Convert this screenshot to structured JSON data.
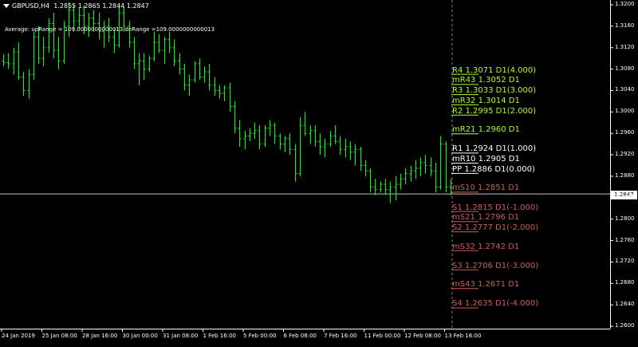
{
  "header": {
    "symbol_timeframe": "GBPUSD,H4",
    "ohlc": "1.2855 1.2865 1.2844 1.2847"
  },
  "indicator_text": "Average: upRange = 109.0000000000013 dnRange =109.0000000000013",
  "current_price_label": "1.2847",
  "colors": {
    "background": "#000000",
    "candle": "#00ff00",
    "axis": "#ffffff",
    "resistance": "#adff2f",
    "pivot": "#ffffff",
    "support": "#cd5c5c",
    "current_line": "#c0c0c0"
  },
  "levels": [
    {
      "label": "R4 1.3071 D1(4.000)",
      "price": 1.3071,
      "kind": "resistance"
    },
    {
      "label": "mR43 1.3052 D1",
      "price": 1.3052,
      "kind": "resistance"
    },
    {
      "label": "R3 1.3033 D1(3.000)",
      "price": 1.3033,
      "kind": "resistance"
    },
    {
      "label": "mR32 1.3014 D1",
      "price": 1.3014,
      "kind": "resistance"
    },
    {
      "label": "R2 1.2995 D1(2.000)",
      "price": 1.2995,
      "kind": "resistance"
    },
    {
      "label": "mR21 1.2960 D1",
      "price": 1.296,
      "kind": "resistance"
    },
    {
      "label": "R1 1.2924 D1(1.000)",
      "price": 1.2924,
      "kind": "pivot"
    },
    {
      "label": "mR10 1.2905 D1",
      "price": 1.2905,
      "kind": "pivot"
    },
    {
      "label": "PP 1.2886 D1(0.000)",
      "price": 1.2886,
      "kind": "pivot"
    },
    {
      "label": "mS10 1.2851 D1",
      "price": 1.2851,
      "kind": "support"
    },
    {
      "label": "S1 1.2815 D1(-1.000)",
      "price": 1.2815,
      "kind": "support"
    },
    {
      "label": "mS21 1.2796 D1",
      "price": 1.2796,
      "kind": "support"
    },
    {
      "label": "S2 1.2777 D1(-2.000)",
      "price": 1.2777,
      "kind": "support"
    },
    {
      "label": "mS32 1.2742 D1",
      "price": 1.2742,
      "kind": "support"
    },
    {
      "label": "S3 1.2706 D1(-3.000)",
      "price": 1.2706,
      "kind": "support"
    },
    {
      "label": "mS43 1.2671 D1",
      "price": 1.2671,
      "kind": "support"
    },
    {
      "label": "S4 1.2635 D1(-4.000)",
      "price": 1.2635,
      "kind": "support"
    }
  ],
  "chart_data": {
    "type": "bar",
    "title": "GBPUSD,H4",
    "price_ticks": [
      "1.3200",
      "1.3160",
      "1.3120",
      "1.3080",
      "1.3040",
      "1.3000",
      "1.2960",
      "1.2920",
      "1.2880",
      "1.2840",
      "1.2800",
      "1.2760",
      "1.2720",
      "1.2680",
      "1.2640",
      "1.2600"
    ],
    "time_ticks": [
      "24 Jan 2019",
      "25 Jan 08:00",
      "28 Jan 16:00",
      "30 Jan 00:00",
      "31 Jan 08:00",
      "1 Feb 16:00",
      "5 Feb 00:00",
      "6 Feb 08:00",
      "7 Feb 16:00",
      "11 Feb 00:00",
      "12 Feb 08:00",
      "13 Feb 16:00"
    ],
    "ylim": [
      1.259,
      1.3205
    ],
    "current_price": 1.2847,
    "series": [
      {
        "ohlc": [
          [
            1.3095,
            1.3108,
            1.3085,
            1.3092
          ],
          [
            1.3092,
            1.311,
            1.308,
            1.309
          ],
          [
            1.309,
            1.312,
            1.307,
            1.3112
          ],
          [
            1.3112,
            1.313,
            1.306,
            1.3065
          ],
          [
            1.3065,
            1.3075,
            1.303,
            1.304
          ],
          [
            1.304,
            1.308,
            1.3025,
            1.307
          ],
          [
            1.307,
            1.315,
            1.306,
            1.314
          ],
          [
            1.314,
            1.316,
            1.309,
            1.31
          ],
          [
            1.31,
            1.314,
            1.3085,
            1.312
          ],
          [
            1.312,
            1.3175,
            1.311,
            1.3165
          ],
          [
            1.3165,
            1.3185,
            1.31,
            1.3115
          ],
          [
            1.3115,
            1.314,
            1.308,
            1.3095
          ],
          [
            1.3095,
            1.317,
            1.309,
            1.316
          ],
          [
            1.316,
            1.3205,
            1.314,
            1.319
          ],
          [
            1.319,
            1.32,
            1.315,
            1.317
          ],
          [
            1.317,
            1.3195,
            1.3155,
            1.318
          ],
          [
            1.318,
            1.32,
            1.3145,
            1.316
          ],
          [
            1.316,
            1.3185,
            1.314,
            1.3175
          ],
          [
            1.3175,
            1.319,
            1.315,
            1.3165
          ],
          [
            1.3165,
            1.3185,
            1.3135,
            1.315
          ],
          [
            1.315,
            1.317,
            1.312,
            1.316
          ],
          [
            1.316,
            1.3175,
            1.313,
            1.314
          ],
          [
            1.314,
            1.3155,
            1.311,
            1.3125
          ],
          [
            1.3125,
            1.32,
            1.312,
            1.3185
          ],
          [
            1.3185,
            1.3195,
            1.315,
            1.316
          ],
          [
            1.316,
            1.317,
            1.312,
            1.313
          ],
          [
            1.313,
            1.314,
            1.308,
            1.309
          ],
          [
            1.309,
            1.311,
            1.305,
            1.3095
          ],
          [
            1.3095,
            1.311,
            1.306,
            1.308
          ],
          [
            1.308,
            1.3105,
            1.3075,
            1.31
          ],
          [
            1.31,
            1.315,
            1.3095,
            1.313
          ],
          [
            1.313,
            1.3145,
            1.311,
            1.3115
          ],
          [
            1.3115,
            1.314,
            1.309,
            1.3135
          ],
          [
            1.3135,
            1.315,
            1.311,
            1.312
          ],
          [
            1.312,
            1.3135,
            1.3085,
            1.3095
          ],
          [
            1.3095,
            1.311,
            1.307,
            1.308
          ],
          [
            1.308,
            1.309,
            1.304,
            1.305
          ],
          [
            1.305,
            1.307,
            1.303,
            1.306
          ],
          [
            1.306,
            1.3095,
            1.3055,
            1.309
          ],
          [
            1.309,
            1.31,
            1.306,
            1.3065
          ],
          [
            1.3065,
            1.3085,
            1.3055,
            1.3075
          ],
          [
            1.3075,
            1.309,
            1.304,
            1.305
          ],
          [
            1.305,
            1.3065,
            1.303,
            1.304
          ],
          [
            1.304,
            1.305,
            1.3025,
            1.3035
          ],
          [
            1.3035,
            1.305,
            1.302,
            1.3045
          ],
          [
            1.3045,
            1.3055,
            1.3,
            1.301
          ],
          [
            1.301,
            1.302,
            1.296,
            1.297
          ],
          [
            1.297,
            1.2985,
            1.2935,
            1.295
          ],
          [
            1.295,
            1.2965,
            1.293,
            1.2955
          ],
          [
            1.2955,
            1.297,
            1.2945,
            1.296
          ],
          [
            1.296,
            1.298,
            1.295,
            1.2965
          ],
          [
            1.2965,
            1.2975,
            1.293,
            1.294
          ],
          [
            1.294,
            1.2975,
            1.2935,
            1.297
          ],
          [
            1.297,
            1.2985,
            1.2955,
            1.2975
          ],
          [
            1.2975,
            1.298,
            1.294,
            1.2955
          ],
          [
            1.2955,
            1.296,
            1.293,
            1.294
          ],
          [
            1.294,
            1.2955,
            1.2925,
            1.295
          ],
          [
            1.295,
            1.296,
            1.292,
            1.293
          ],
          [
            1.293,
            1.294,
            1.287,
            1.2885
          ],
          [
            1.2885,
            1.299,
            1.288,
            1.2975
          ],
          [
            1.2975,
            1.3,
            1.2955,
            1.296
          ],
          [
            1.296,
            1.2975,
            1.294,
            1.2965
          ],
          [
            1.2965,
            1.2975,
            1.2935,
            1.2945
          ],
          [
            1.2945,
            1.296,
            1.292,
            1.2935
          ],
          [
            1.2935,
            1.295,
            1.2915,
            1.294
          ],
          [
            1.294,
            1.2965,
            1.2935,
            1.2955
          ],
          [
            1.2955,
            1.2975,
            1.294,
            1.2945
          ],
          [
            1.2945,
            1.2955,
            1.292,
            1.293
          ],
          [
            1.293,
            1.295,
            1.2915,
            1.2935
          ],
          [
            1.2935,
            1.2945,
            1.291,
            1.2925
          ],
          [
            1.2925,
            1.294,
            1.29,
            1.293
          ],
          [
            1.293,
            1.2935,
            1.289,
            1.29
          ],
          [
            1.29,
            1.291,
            1.288,
            1.289
          ],
          [
            1.289,
            1.2895,
            1.285,
            1.286
          ],
          [
            1.286,
            1.2875,
            1.2845,
            1.2855
          ],
          [
            1.2855,
            1.287,
            1.285,
            1.2865
          ],
          [
            1.2865,
            1.2875,
            1.2845,
            1.2855
          ],
          [
            1.2855,
            1.287,
            1.283,
            1.286
          ],
          [
            1.286,
            1.288,
            1.2835,
            1.2865
          ],
          [
            1.2865,
            1.2885,
            1.2855,
            1.2875
          ],
          [
            1.2875,
            1.2895,
            1.2865,
            1.2885
          ],
          [
            1.2885,
            1.29,
            1.287,
            1.289
          ],
          [
            1.289,
            1.291,
            1.2875,
            1.2895
          ],
          [
            1.2895,
            1.2915,
            1.288,
            1.2905
          ],
          [
            1.2905,
            1.292,
            1.2885,
            1.29
          ],
          [
            1.29,
            1.2915,
            1.288,
            1.289
          ],
          [
            1.289,
            1.2905,
            1.285,
            1.286
          ],
          [
            1.286,
            1.2955,
            1.2855,
            1.294
          ],
          [
            1.294,
            1.2945,
            1.285,
            1.286
          ],
          [
            1.286,
            1.2875,
            1.2844,
            1.2847
          ]
        ]
      }
    ]
  }
}
